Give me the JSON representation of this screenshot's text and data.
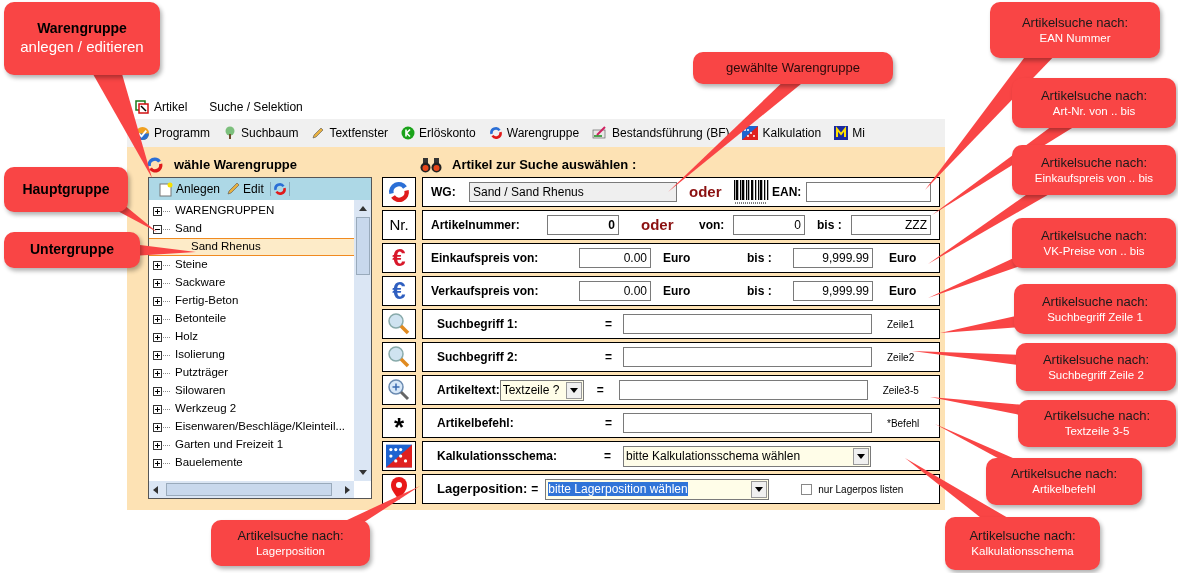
{
  "menu": [
    {
      "label": "Artikel",
      "kind": "app"
    },
    {
      "label": "Suche / Selektion",
      "kind": "plain"
    }
  ],
  "toolbar": [
    {
      "label": "Programm",
      "kind": "program"
    },
    {
      "label": "Suchbaum",
      "kind": "tree"
    },
    {
      "label": "Textfenster",
      "kind": "pencil"
    },
    {
      "label": "Erlöskonto",
      "kind": "account"
    },
    {
      "label": "Warengruppe",
      "kind": "group"
    },
    {
      "label": "Bestandsführung (BF)",
      "kind": "stock"
    },
    {
      "label": "Kalkulation",
      "kind": "calc"
    },
    {
      "label": "Mi",
      "kind": "m"
    }
  ],
  "group_panel": {
    "title": "wähle Warengruppe",
    "tools": [
      {
        "label": "Anlegen",
        "kind": "new"
      },
      {
        "label": "Edit",
        "kind": "edit"
      }
    ],
    "tree": [
      {
        "label": "WARENGRUPPEN",
        "expanded": false
      },
      {
        "label": "Sand",
        "expanded": true,
        "children": [
          {
            "label": "Sand Rhenus",
            "selected": true
          }
        ]
      },
      {
        "label": "Steine",
        "expanded": false
      },
      {
        "label": "Sackware",
        "expanded": false
      },
      {
        "label": "Fertig-Beton",
        "expanded": false
      },
      {
        "label": "Betonteile",
        "expanded": false
      },
      {
        "label": "Holz",
        "expanded": false
      },
      {
        "label": "Isolierung",
        "expanded": false
      },
      {
        "label": "Putzträger",
        "expanded": false
      },
      {
        "label": "Silowaren",
        "expanded": false
      },
      {
        "label": "Werkzeug 2",
        "expanded": false
      },
      {
        "label": "Eisenwaren/Beschläge/Kleinteil...",
        "expanded": false
      },
      {
        "label": "Garten und Freizeit 1",
        "expanded": false
      },
      {
        "label": "Bauelemente",
        "expanded": false
      }
    ]
  },
  "search_panel": {
    "title": "Artikel zur Suche auswählen :",
    "rows": [
      {
        "kind": "wg",
        "label": "WG:",
        "value": "Sand / Sand Rhenus",
        "or": "oder",
        "ean_label": "EAN:"
      },
      {
        "kind": "number",
        "icon_text": "Nr.",
        "label": "Artikelnummer:",
        "value": "0",
        "or": "oder",
        "from_label": "von:",
        "from": "0",
        "to_label": "bis :",
        "to": "ZZZ"
      },
      {
        "kind": "price",
        "icon_text": "€",
        "color": "#d8182a",
        "label": "Einkaufspreis  von:",
        "from": "0.00",
        "unit": "Euro",
        "to_label": "bis :",
        "to": "9,999.99",
        "unit2": "Euro"
      },
      {
        "kind": "price",
        "icon_text": "€",
        "color": "#2f5fc0",
        "label": "Verkaufspreis  von:",
        "from": "0.00",
        "unit": "Euro",
        "to_label": "bis :",
        "to": "9,999.99",
        "unit2": "Euro"
      },
      {
        "kind": "text",
        "label": "Suchbegriff 1:",
        "eq": "=",
        "hint": "Zeile1"
      },
      {
        "kind": "text",
        "label": "Suchbegriff 2:",
        "eq": "=",
        "hint": "Zeile2"
      },
      {
        "kind": "textselect",
        "label": "Artikeltext:",
        "select": "Textzeile ?",
        "eq": "=",
        "hint": "Zeile3-5"
      },
      {
        "kind": "text",
        "icon_text": "*",
        "label": "Artikelbefehl:",
        "eq": "=",
        "hint": "*Befehl"
      },
      {
        "kind": "calc",
        "label": "Kalkulationsschema:",
        "eq": "=",
        "select": "bitte Kalkulationsschema wählen"
      },
      {
        "kind": "location",
        "label": "Lagerposition:",
        "eq": "=",
        "select": "bitte Lagerposition wählen",
        "check_label": "nur Lagerpos listen",
        "checked": false
      }
    ]
  },
  "callouts": [
    {
      "kind": "heading",
      "title": "Warengruppe",
      "subtitle": "anlegen / editieren"
    },
    {
      "kind": "heading",
      "title": "Hauptgruppe"
    },
    {
      "kind": "heading",
      "title": "Untergruppe"
    },
    {
      "kind": "note",
      "title": "gewählte Warengruppe"
    },
    {
      "kind": "search",
      "title": "Artikelsuche nach:",
      "subtitle": "EAN Nummer"
    },
    {
      "kind": "search",
      "title": "Artikelsuche nach:",
      "subtitle": "Art-Nr. von .. bis"
    },
    {
      "kind": "search",
      "title": "Artikelsuche nach:",
      "subtitle": "Einkaufspreis von .. bis"
    },
    {
      "kind": "search",
      "title": "Artikelsuche nach:",
      "subtitle": "VK-Preise von .. bis"
    },
    {
      "kind": "search",
      "title": "Artikelsuche nach:",
      "subtitle": "Suchbegriff Zeile 1"
    },
    {
      "kind": "search",
      "title": "Artikelsuche nach:",
      "subtitle": "Suchbegriff Zeile 2"
    },
    {
      "kind": "search",
      "title": "Artikelsuche nach:",
      "subtitle": "Textzeile 3-5"
    },
    {
      "kind": "search",
      "title": "Artikelsuche nach:",
      "subtitle": "Artikelbefehl"
    },
    {
      "kind": "search",
      "title": "Artikelsuche nach:",
      "subtitle": "Lagerposition"
    },
    {
      "kind": "search",
      "title": "Artikelsuche nach:",
      "subtitle": "Kalkulationsschema"
    }
  ]
}
